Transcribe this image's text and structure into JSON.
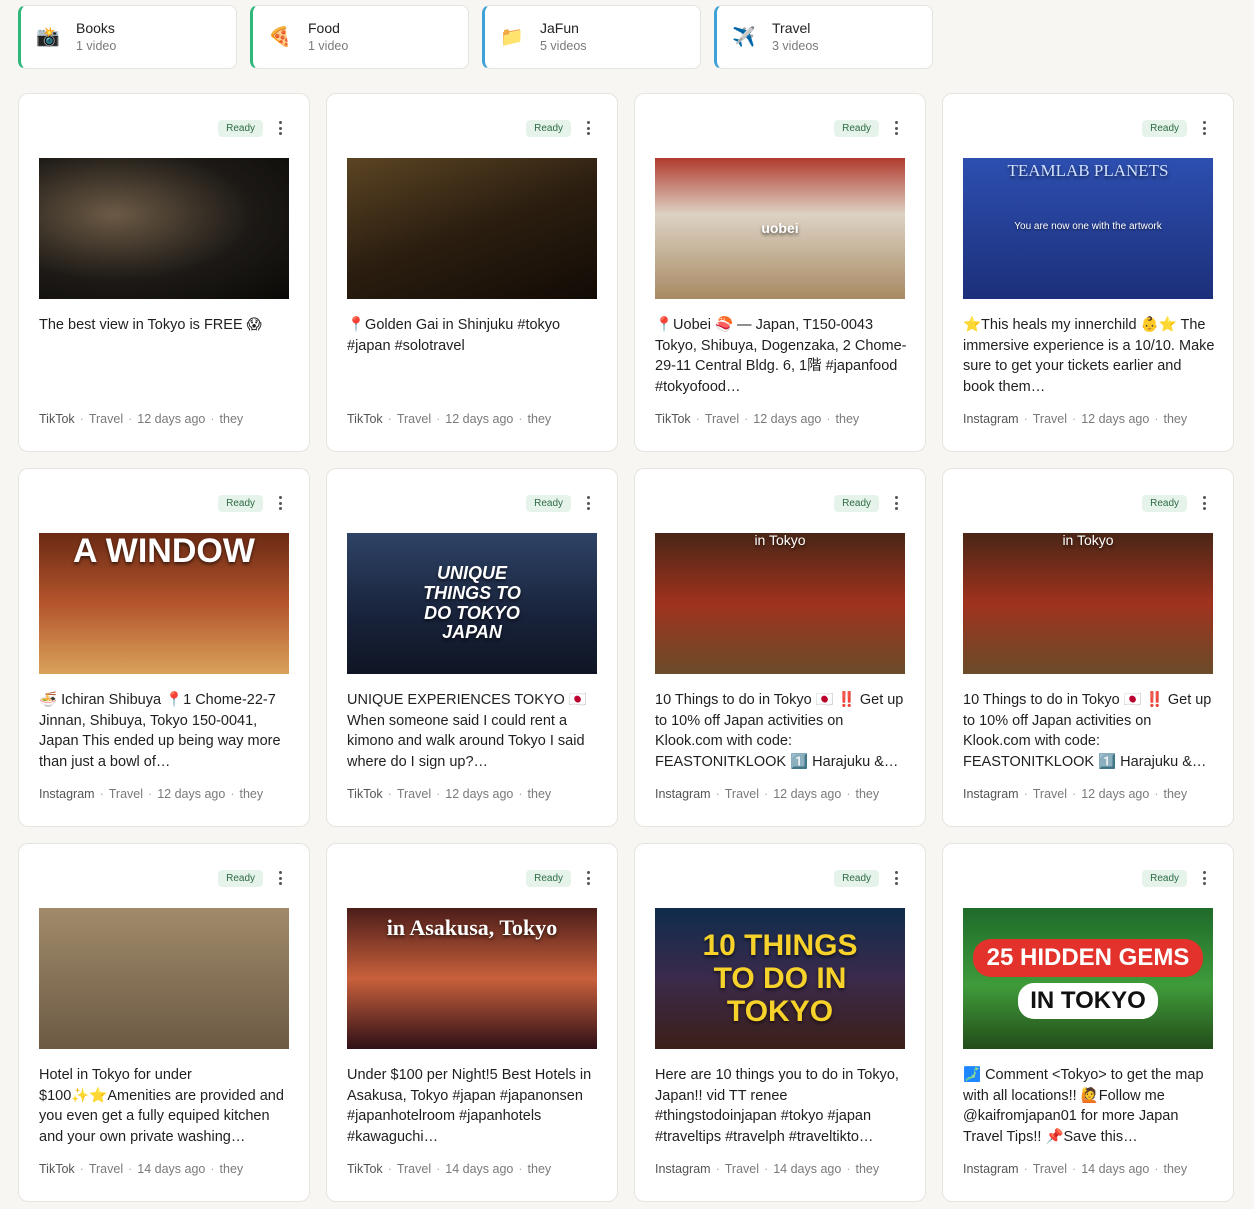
{
  "collections": [
    {
      "icon": "📸",
      "icon_name": "camera-icon",
      "name": "Books",
      "count": "1 video",
      "color": "#2fb77b"
    },
    {
      "icon": "🍕",
      "icon_name": "pizza-icon",
      "name": "Food",
      "count": "1 video",
      "color": "#2fb77b"
    },
    {
      "icon": "📁",
      "icon_name": "folder-icon",
      "name": "JaFun",
      "count": "5 videos",
      "color": "#3fa2d6"
    },
    {
      "icon": "✈️",
      "icon_name": "airplane-icon",
      "name": "Travel",
      "count": "3 videos",
      "color": "#3fa2d6"
    }
  ],
  "cards": [
    {
      "status": "Ready",
      "thumb_text": "",
      "title": "The best view in Tokyo is FREE 😱",
      "source": "TikTok",
      "collection": "Travel",
      "time": "12 days ago",
      "author": "they"
    },
    {
      "status": "Ready",
      "thumb_text": "",
      "title": "📍Golden Gai in Shinjuku #tokyo #japan #solotravel",
      "source": "TikTok",
      "collection": "Travel",
      "time": "12 days ago",
      "author": "they"
    },
    {
      "status": "Ready",
      "thumb_text": "uobei",
      "title": "📍Uobei 🍣 — Japan, T150-0043 Tokyo, Shibuya, Dogenzaka, 2 Chome-29-11 Central Bldg. 6, 1階 #japanfood #tokyofood…",
      "source": "TikTok",
      "collection": "Travel",
      "time": "12 days ago",
      "author": "they"
    },
    {
      "status": "Ready",
      "thumb_text": "TEAMLAB PLANETS",
      "thumb_sub": "You are now one with the artwork",
      "title": "⭐This heals my innerchild 👶⭐ The immersive experience is a 10/10. Make sure to get your tickets earlier and book them…",
      "source": "Instagram",
      "collection": "Travel",
      "time": "12 days ago",
      "author": "they"
    },
    {
      "status": "Ready",
      "thumb_text": "A WINDOW",
      "title": "🍜 Ichiran Shibuya 📍1 Chome-22-7 Jinnan, Shibuya, Tokyo 150-0041, Japan This ended up being way more than just a bowl of…",
      "source": "Instagram",
      "collection": "Travel",
      "time": "12 days ago",
      "author": "they"
    },
    {
      "status": "Ready",
      "thumb_text": "UNIQUE THINGS TO DO TOKYO JAPAN",
      "title": "UNIQUE EXPERIENCES TOKYO 🇯🇵 When someone said I could rent a kimono and walk around Tokyo I said where do I sign up?…",
      "source": "TikTok",
      "collection": "Travel",
      "time": "12 days ago",
      "author": "they"
    },
    {
      "status": "Ready",
      "thumb_text": "in Tokyo",
      "title": "10 Things to do in Tokyo 🇯🇵 ‼️ Get up to 10% off Japan activities on Klook.com with code: FEASTONITKLOOK 1️⃣ Harajuku &…",
      "source": "Instagram",
      "collection": "Travel",
      "time": "12 days ago",
      "author": "they"
    },
    {
      "status": "Ready",
      "thumb_text": "in Tokyo",
      "title": "10 Things to do in Tokyo 🇯🇵 ‼️ Get up to 10% off Japan activities on Klook.com with code: FEASTONITKLOOK 1️⃣ Harajuku &…",
      "source": "Instagram",
      "collection": "Travel",
      "time": "12 days ago",
      "author": "they"
    },
    {
      "status": "Ready",
      "thumb_text": "",
      "title": "Hotel in Tokyo for under $100✨⭐Amenities are provided and you even get a fully equiped kitchen and your own private washing…",
      "source": "TikTok",
      "collection": "Travel",
      "time": "14 days ago",
      "author": "they"
    },
    {
      "status": "Ready",
      "thumb_text": "in Asakusa, Tokyo",
      "title": "Under $100 per Night!5 Best Hotels in Asakusa, Tokyo #japan #japanonsen #japanhotelroom #japanhotels #kawaguchi…",
      "source": "TikTok",
      "collection": "Travel",
      "time": "14 days ago",
      "author": "they"
    },
    {
      "status": "Ready",
      "thumb_text": "10 THINGS TO DO IN TOKYO",
      "title": "Here are 10 things you to do in Tokyo, Japan!! vid TT renee #thingstodoinjapan #tokyo #japan #traveltips #travelph #traveltikto…",
      "source": "Instagram",
      "collection": "Travel",
      "time": "14 days ago",
      "author": "they"
    },
    {
      "status": "Ready",
      "thumb_text": "25 HIDDEN GEMS",
      "thumb_text2": "IN TOKYO",
      "title": "🗾 Comment <Tokyo> to get the map with all locations!! 🙋Follow me @kaifromjapan01 for more Japan Travel Tips!! 📌Save this…",
      "source": "Instagram",
      "collection": "Travel",
      "time": "14 days ago",
      "author": "they"
    }
  ]
}
